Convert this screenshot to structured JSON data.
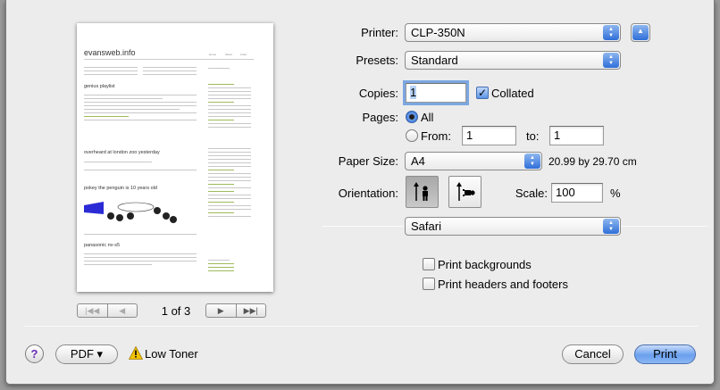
{
  "preview": {
    "site_title": "evansweb.info",
    "nav": [
      "Home",
      "About",
      "Links"
    ],
    "post_titles": [
      "genius playlist",
      "overheard at london zoo yesterday",
      "pokey the penguin is 10 years old",
      "panasonic nv-s5"
    ],
    "page_indicator": "1 of 3"
  },
  "printer": {
    "label": "Printer:",
    "value": "CLP-350N"
  },
  "presets": {
    "label": "Presets:",
    "value": "Standard"
  },
  "copies": {
    "label": "Copies:",
    "value": "1",
    "collated_label": "Collated",
    "collated": true
  },
  "pages": {
    "label": "Pages:",
    "all_label": "All",
    "from_label": "From:",
    "from_value": "1",
    "to_label": "to:",
    "to_value": "1",
    "selected": "all"
  },
  "paper_size": {
    "label": "Paper Size:",
    "value": "A4",
    "dimensions": "20.99 by 29.70 cm"
  },
  "orientation": {
    "label": "Orientation:",
    "selected": "portrait"
  },
  "scale": {
    "label": "Scale:",
    "value": "100",
    "unit": "%"
  },
  "section_popup": {
    "value": "Safari"
  },
  "options": [
    {
      "label": "Print backgrounds",
      "checked": false
    },
    {
      "label": "Print headers and footers",
      "checked": false
    }
  ],
  "footer": {
    "help": "?",
    "pdf_label": "PDF ▾",
    "toner_label": "Low Toner",
    "cancel_label": "Cancel",
    "print_label": "Print"
  },
  "colors": {
    "accent": "#2f6fd9",
    "default_button": "#6aa0ee",
    "toner_warning": "#f2c200"
  }
}
